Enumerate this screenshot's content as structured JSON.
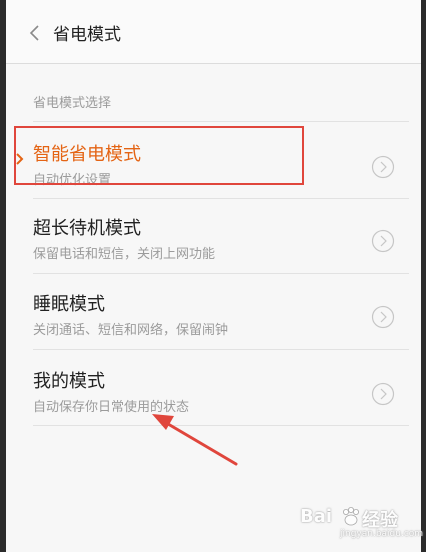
{
  "header": {
    "title": "省电模式"
  },
  "section": {
    "label": "省电模式选择"
  },
  "modes": [
    {
      "title": "智能省电模式",
      "subtitle": "自动优化设置",
      "active": true
    },
    {
      "title": "超长待机模式",
      "subtitle": "保留电话和短信，关闭上网功能",
      "active": false
    },
    {
      "title": "睡眠模式",
      "subtitle": "关闭通话、短信和网络，保留闹钟",
      "active": false
    },
    {
      "title": "我的模式",
      "subtitle": "自动保存你日常使用的状态",
      "active": false
    }
  ],
  "colors": {
    "accent": "#e46414",
    "annotation": "#e0463c"
  },
  "icons": {
    "back": "chevron-left-icon",
    "item": "chevron-right-circle-icon"
  },
  "watermark": {
    "left": "Bai",
    "right": "经验",
    "sub": "jingyan.baidu.com"
  }
}
